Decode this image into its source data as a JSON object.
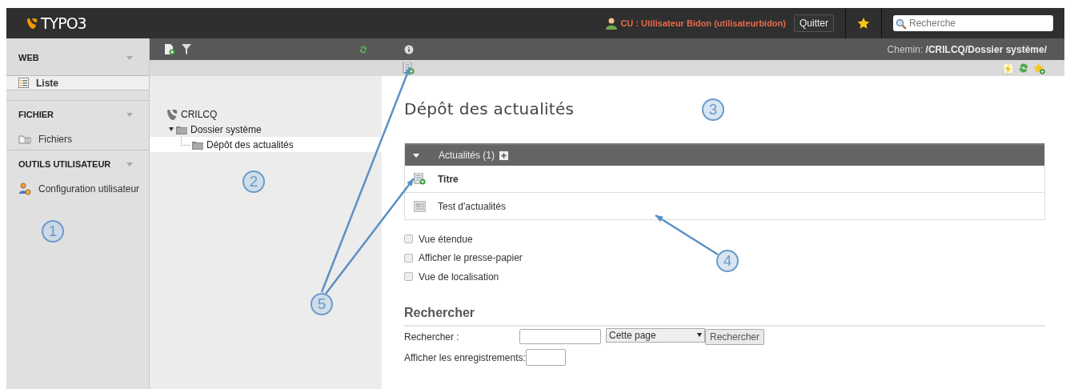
{
  "topbar": {
    "logo": "TYPO3",
    "user": "CU : Utilisateur Bidon (utilisateurbidon)",
    "logout_button": "Quitter",
    "search": {
      "placeholder": "Recherche"
    }
  },
  "sidebar": {
    "groups": [
      {
        "title": "WEB",
        "expanded": true,
        "items": [
          {
            "label": "Liste",
            "kind": "list",
            "selected": true
          }
        ]
      },
      {
        "title": "FICHIER",
        "expanded": true,
        "items": [
          {
            "label": "Fichiers",
            "kind": "files",
            "selected": false
          }
        ]
      },
      {
        "title": "OUTILS UTILISATEUR",
        "expanded": true,
        "items": [
          {
            "label": "Configuration utilisateur",
            "kind": "user",
            "selected": false
          }
        ]
      }
    ]
  },
  "page_tree": {
    "nodes": [
      {
        "label": "CRILCQ",
        "kind": "root",
        "selected": false,
        "children": [
          {
            "label": "Dossier système",
            "kind": "folder",
            "expanded": true,
            "selected": false,
            "children": [
              {
                "label": "Dépôt des actualités",
                "kind": "folder",
                "selected": true
              }
            ]
          }
        ]
      }
    ]
  },
  "path": {
    "label": "Chemin:",
    "value": "/CRILCQ/Dossier système/"
  },
  "content": {
    "title": "Dépôt des actualités",
    "table": {
      "title": "Actualités (1)",
      "expanded": true,
      "header": "Titre",
      "rows": [
        "Test d'actualités"
      ]
    },
    "options": [
      {
        "label": "Vue étendue",
        "checked": false
      },
      {
        "label": "Afficher le presse-papier",
        "checked": false
      },
      {
        "label": "Vue de localisation",
        "checked": false
      }
    ],
    "search": {
      "heading": "Rechercher",
      "label": "Rechercher :",
      "scope": "Cette page",
      "button": "Rechercher",
      "records_label": "Afficher les enregistrements:"
    }
  },
  "callouts": [
    {
      "label": "1"
    },
    {
      "label": "2"
    },
    {
      "label": "3"
    },
    {
      "label": "4"
    },
    {
      "label": "5"
    }
  ]
}
